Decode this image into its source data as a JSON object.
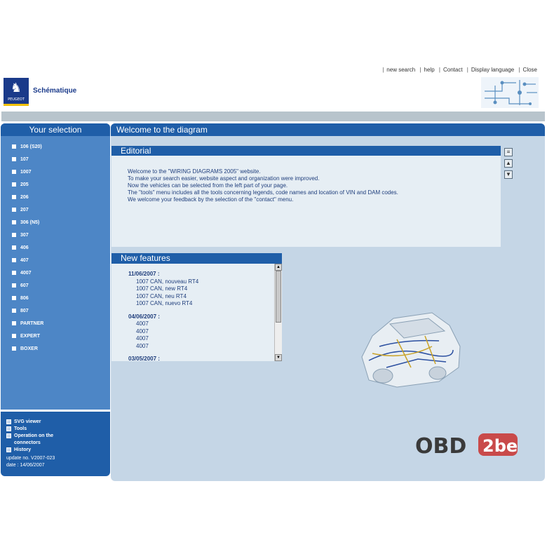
{
  "header": {
    "nav": [
      "new search",
      "help",
      "Contact",
      "Display language",
      "Close"
    ],
    "brand": "PEUGEOT",
    "app_title": "Schématique"
  },
  "sidebar": {
    "title": "Your selection",
    "models": [
      "106 (S20)",
      "107",
      "1007",
      "205",
      "206",
      "207",
      "306 (N5)",
      "307",
      "406",
      "407",
      "4007",
      "607",
      "806",
      "807",
      "PARTNER",
      "EXPERT",
      "BOXER"
    ],
    "tools": [
      "SVG viewer",
      "Tools",
      "Operation on the connectors",
      "History"
    ],
    "update": "update no. V2007-023",
    "date": "date : 14/06/2007"
  },
  "main": {
    "title": "Welcome to the diagram",
    "editorial": {
      "title": "Editorial",
      "lines": [
        "Welcome to the \"WIRING DIAGRAMS 2005\" website.",
        "To make your search easier, website aspect and organization were improved.",
        "Now the vehicles can be selected from the left part of your page.",
        "The \"tools\" menu includes all the tools concerning legends, code names and location of VIN and DAM codes.",
        "We welcome your feedback by the selection of the \"contact\" menu."
      ]
    },
    "new_features": {
      "title": "New features",
      "groups": [
        {
          "date": "11/06/2007 :",
          "items": [
            "1007 CAN, nouveau RT4",
            "1007 CAN, new RT4",
            "1007 CAN, neu RT4",
            "1007 CAN, nuevo RT4"
          ]
        },
        {
          "date": "04/06/2007 :",
          "items": [
            "4007",
            "4007",
            "4007",
            "4007"
          ]
        },
        {
          "date": "03/05/2007 :",
          "items": []
        }
      ]
    },
    "watermark": "OBD2be"
  },
  "colors": {
    "accent": "#1f5ea8",
    "sidebar": "#4d86c6",
    "panel": "#c5d6e6"
  }
}
